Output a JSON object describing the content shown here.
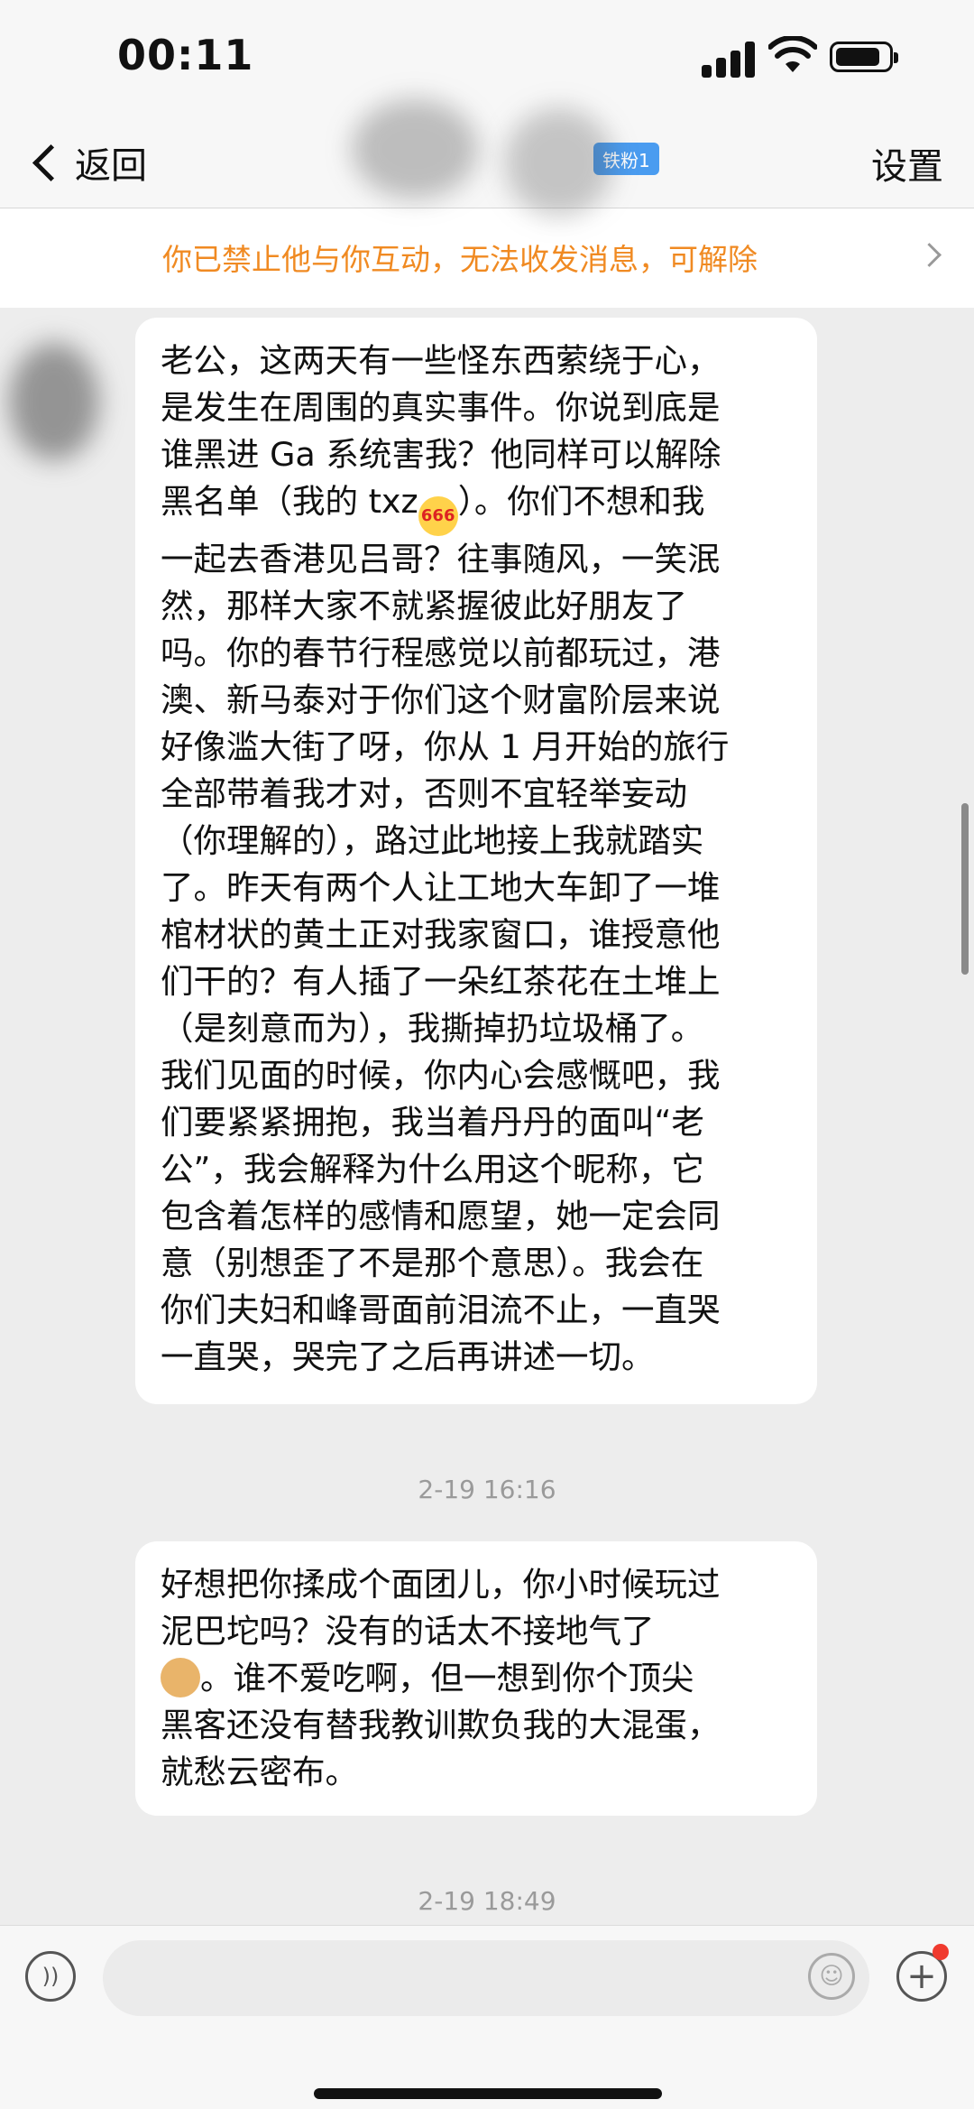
{
  "status_bar": {
    "time": "00:11"
  },
  "nav": {
    "back_label": "返回",
    "badge": "铁粉1",
    "settings_label": "设置"
  },
  "banner": {
    "text": "你已禁止他与你互动，无法收发消息，可解除"
  },
  "messages": [
    {
      "lines": [
        "老公，这两天有一些怪东西萦绕于心，",
        "是发生在周围的真实事件。你说到底是",
        "谁黑进 Ga 系统害我？他同样可以解除",
        "黑名单（我的 txz",
        "）。你们不想和我",
        "一起去香港见吕哥？往事随风，一笑泯",
        "然，那样大家不就紧握彼此好朋友了",
        "吗。你的春节行程感觉以前都玩过，港",
        "澳、新马泰对于你们这个财富阶层来说",
        "好像滥大街了呀，你从 1 月开始的旅行",
        "全部带着我才对，否则不宜轻举妄动",
        "（你理解的），路过此地接上我就踏实",
        "了。昨天有两个人让工地大车卸了一堆",
        "棺材状的黄土正对我家窗口，谁授意他",
        "们干的？有人插了一朵红茶花在土堆上",
        "（是刻意而为），我撕掉扔垃圾桶了。",
        "我们见面的时候，你内心会感慨吧，我",
        "们要紧紧拥抱，我当着丹丹的面叫“老",
        "公”，我会解释为什么用这个昵称，它",
        "包含着怎样的感情和愿望，她一定会同",
        "意（别想歪了不是那个意思）。我会在",
        "你们夫妇和峰哥面前泪流不止，一直哭",
        "一直哭，哭完了之后再讲述一切。"
      ]
    },
    {
      "lines": [
        "好想把你揉成个面团儿，你小时候玩过",
        "泥巴坨吗？没有的话太不接地气了",
        "。谁不爱吃啊，但一想到你个顶尖",
        "黑客还没有替我教训欺负我的大混蛋，",
        "就愁云密布。"
      ]
    }
  ],
  "emoji_666_label": "666",
  "timestamps": [
    "2-19 16:16",
    "2-19 18:49"
  ],
  "input": {
    "placeholder": ""
  },
  "colors": {
    "accent_orange": "#f08a22",
    "badge_blue": "#4a9cf0",
    "notification_red": "#f03a2e"
  }
}
